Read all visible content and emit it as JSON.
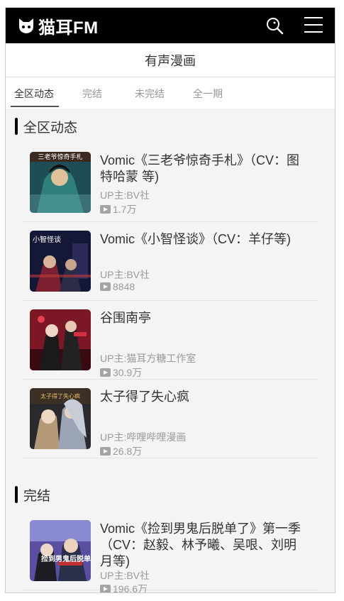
{
  "header": {
    "logo_text": "猫耳FM"
  },
  "page_title": "有声漫画",
  "tabs": [
    {
      "label": "全区动态",
      "active": true
    },
    {
      "label": "完结",
      "active": false
    },
    {
      "label": "未完结",
      "active": false
    },
    {
      "label": "全一期",
      "active": false
    }
  ],
  "sections": [
    {
      "title": "全区动态",
      "items": [
        {
          "title": "Vomic《三老爷惊奇手札》（CV：图特哈蒙 等)",
          "uploader": "UP主:BV社",
          "plays": "1.7万",
          "cover_text": "三老爷惊奇手札"
        },
        {
          "title": "Vomic《小智怪谈》（CV：羊仔等)",
          "uploader": "UP主:BV社",
          "plays": "8848",
          "cover_text": "小智怪谈"
        },
        {
          "title": "谷围南亭",
          "uploader": "UP主:猫耳方糖工作室",
          "plays": "30.9万",
          "cover_text": ""
        },
        {
          "title": "太子得了失心疯",
          "uploader": "UP主:哔哩哔哩漫画",
          "plays": "26.8万",
          "cover_text": "太子得了失心疯"
        }
      ]
    },
    {
      "title": "完结",
      "items": [
        {
          "title": "Vomic《捡到男鬼后脱单了》第一季（CV：赵毅、林予曦、吴哏、刘明月等)",
          "uploader": "UP主:BV社",
          "plays": "196.6万",
          "cover_text": "捡到男鬼后脱单了"
        }
      ]
    }
  ],
  "colors": {
    "header_bg": "#000000",
    "page_bg": "#f4f4f4",
    "muted_text": "#9a9a9a"
  },
  "icons": {
    "search": "search-icon",
    "menu": "menu-icon",
    "play": "play-count-icon",
    "logo": "cat-head-icon"
  }
}
